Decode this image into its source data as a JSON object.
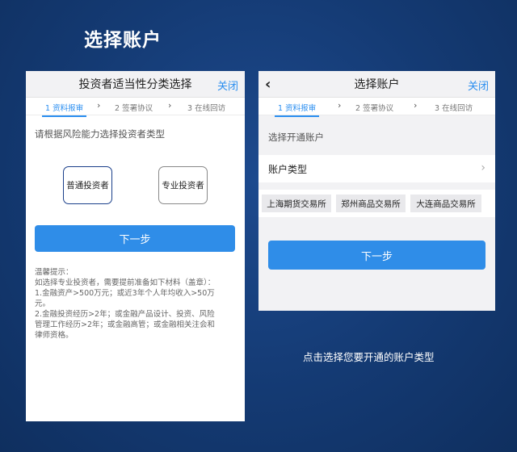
{
  "page": {
    "title": "选择账户",
    "caption": "点击选择您要开通的账户类型"
  },
  "left": {
    "nav": {
      "title": "投资者适当性分类选择",
      "close": "关闭"
    },
    "steps": [
      "1 资料报审",
      "2 签署协议",
      "3 在线回访"
    ],
    "prompt": "请根据风险能力选择投资者类型",
    "types": [
      "普通投资者",
      "专业投资者"
    ],
    "next": "下一步",
    "tips": [
      "温馨提示：",
      "如选择专业投资者，需要提前准备如下材料（盖章）：",
      "1.金融资产>500万元；或近3年个人年均收入>50万",
      "元。",
      "2.金融投资经历>2年；或金融产品设计、投资、风险",
      "管理工作经历>2年；或金融高管；或金融相关注会和",
      "律师资格。"
    ]
  },
  "right": {
    "nav": {
      "back": "‹",
      "title": "选择账户",
      "close": "关闭"
    },
    "steps": [
      "1 资料报审",
      "2 签署协议",
      "3 在线回访"
    ],
    "section": "选择开通账户",
    "account_type": "账户类型",
    "exchanges": [
      "上海期货交易所",
      "郑州商品交易所",
      "大连商品交易所"
    ],
    "next": "下一步"
  },
  "colors": {
    "accent": "#2f8de8",
    "link": "#2a8ef0",
    "background": "#143a73"
  }
}
